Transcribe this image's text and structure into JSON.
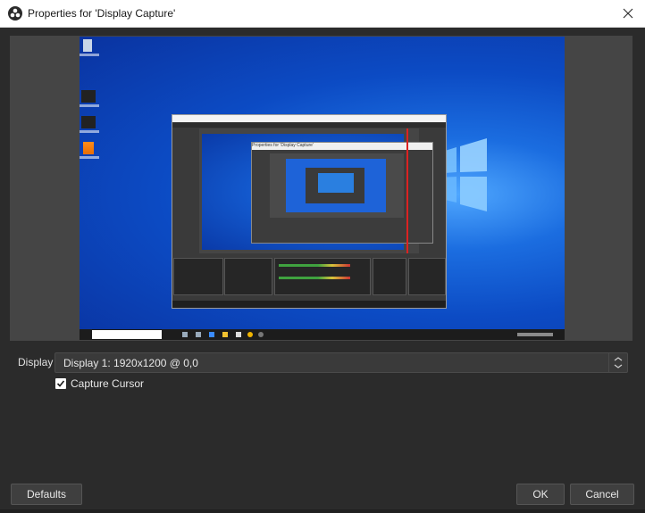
{
  "window": {
    "title": "Properties for 'Display Capture'"
  },
  "preview": {
    "inner_dialog_title": "Properties for 'Display Capture'"
  },
  "form": {
    "display_label": "Display",
    "display_value": "Display 1: 1920x1200 @ 0,0",
    "capture_cursor_label": "Capture Cursor",
    "capture_cursor_checked": true
  },
  "buttons": {
    "defaults": "Defaults",
    "ok": "OK",
    "cancel": "Cancel"
  },
  "icons": [
    "obs-logo-icon",
    "close-icon",
    "checkmark-icon",
    "spinner-arrows-icon",
    "windows-logo-icon"
  ],
  "colors": {
    "dialog_bg": "#2b2b2b",
    "desktop_blue": "#0c4bc4",
    "accent_red": "#d22222"
  }
}
